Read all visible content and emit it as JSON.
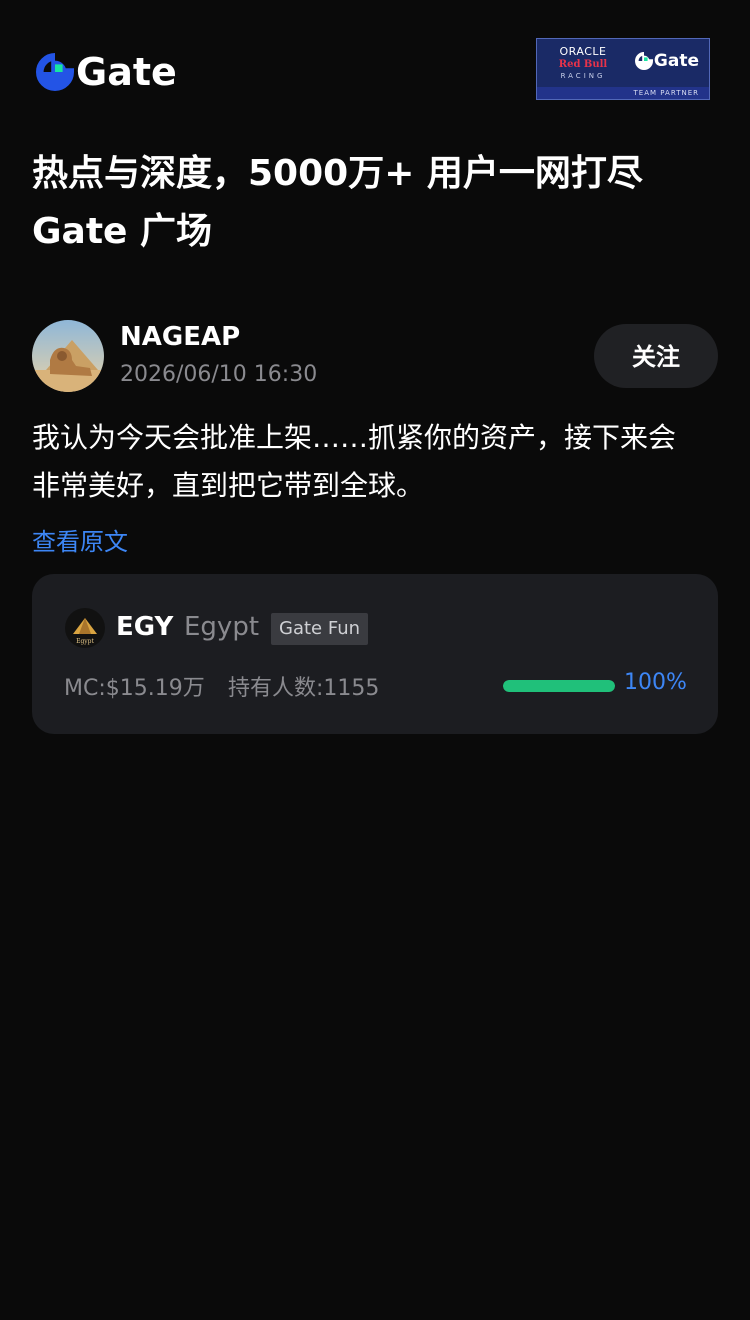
{
  "header": {
    "logo_text": "Gate",
    "partner": {
      "oracle": "ORACLE",
      "redbull": "Red Bull",
      "racing": "RACING",
      "gate_text": "Gate",
      "strip": "TEAM PARTNER"
    }
  },
  "headline": {
    "line1": "热点与深度，5000万+ 用户一网打尽",
    "line2": "Gate 广场"
  },
  "post": {
    "author": "NAGEAP",
    "time": "2026/06/10 16:30",
    "follow_label": "关注",
    "body_line1": "我认为今天会批准上架……抓紧你的资产，接下来会",
    "body_line2": "非常美好，直到把它带到全球。",
    "view_original": "查看原文"
  },
  "token": {
    "symbol": "EGY",
    "name": "Egypt",
    "badge": "Gate Fun",
    "mc": "MC:$15.19万",
    "holders": "持有人数:1155",
    "progress_label": "100%",
    "progress_value": 1.0,
    "icon_caption": "Egypt",
    "colors": {
      "progress": "#20c07a",
      "accent": "#3d86f5"
    }
  }
}
